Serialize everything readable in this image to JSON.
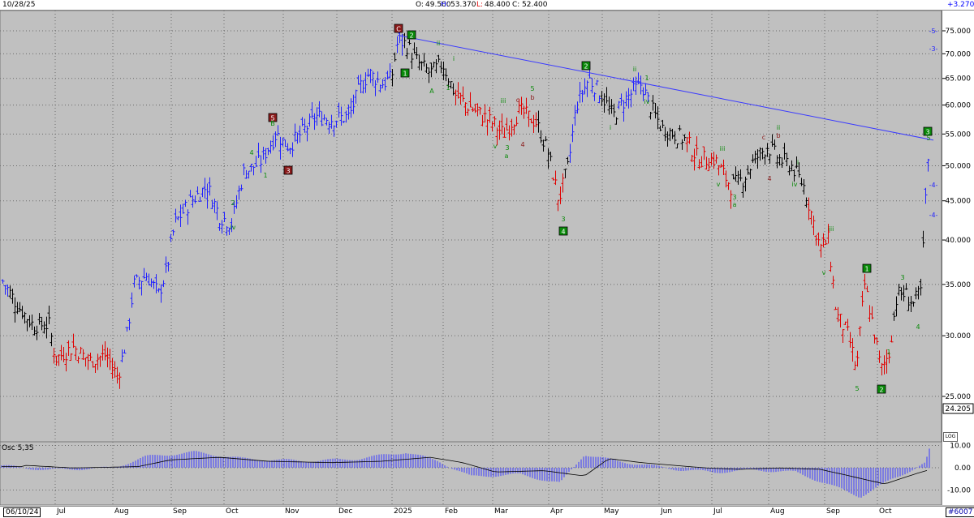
{
  "header": {
    "date": "10/28/25",
    "open_label": "O:",
    "open": "49.500",
    "high_label": "H:",
    "high": "53.370",
    "low_label": "L:",
    "low": "48.400",
    "close_label": "C:",
    "close": "52.400",
    "change": "+3.270"
  },
  "x_axis": {
    "start_date": "06/10/24",
    "months": [
      "Jul",
      "Aug",
      "Sep",
      "Oct",
      "Nov",
      "Dec",
      "2025",
      "Feb",
      "Mar",
      "Apr",
      "May",
      "Jun",
      "Jul",
      "Aug",
      "Sep",
      "Oct"
    ],
    "end_label": "#6007"
  },
  "price_scale": {
    "ticks": [
      "75.000",
      "70.000",
      "65.000",
      "60.000",
      "55.000",
      "50.000",
      "45.000",
      "40.000",
      "35.000",
      "30.000",
      "25.000"
    ],
    "last_price": "24.205"
  },
  "osc": {
    "title": "Osc 5,35",
    "ticks": [
      "10.00",
      "0.00",
      "-10.00"
    ]
  },
  "log_button": "LOG",
  "colors": {
    "up": "#2222ff",
    "down": "#e00000",
    "neutral": "#000000",
    "wave_green": "#0a8a0a",
    "wave_red": "#8b1a1a",
    "trend": "#3a3aff"
  },
  "chart_data": {
    "type": "ohlc",
    "log_scale": true,
    "ylim": [
      24,
      78
    ],
    "grid": true,
    "x": [
      "Jun",
      "Jul",
      "Aug",
      "Sep",
      "Oct",
      "Nov",
      "Dec",
      "Jan",
      "Feb",
      "Mar",
      "Apr",
      "May",
      "Jun",
      "Jul",
      "Aug",
      "Sep",
      "Oct"
    ],
    "approx_close": [
      33.5,
      29,
      27.5,
      45,
      42,
      54,
      60,
      72,
      62,
      56,
      47,
      64,
      57,
      48,
      52,
      38,
      28,
      34,
      52
    ],
    "trendline": {
      "from_price": 74,
      "to_price": 54
    },
    "right_labels": [
      "-5-",
      "-3-",
      "-4-",
      "-4-"
    ],
    "wave_labels": [
      "C",
      "2",
      "1",
      "ii",
      "i",
      "1",
      "A",
      "5",
      "B",
      "3",
      "4",
      "1",
      "2",
      "iv",
      "iii",
      "v",
      "3",
      "a",
      "c",
      "b",
      "4",
      "5",
      "3",
      "4",
      "2",
      "ii",
      "1",
      "i",
      "iv",
      "iii",
      "v",
      "3",
      "a",
      "c",
      "b",
      "4",
      "ii",
      "i",
      "iv",
      "iii",
      "v",
      "5",
      "1",
      "2",
      "1",
      "3",
      "4",
      "3",
      "5"
    ]
  }
}
